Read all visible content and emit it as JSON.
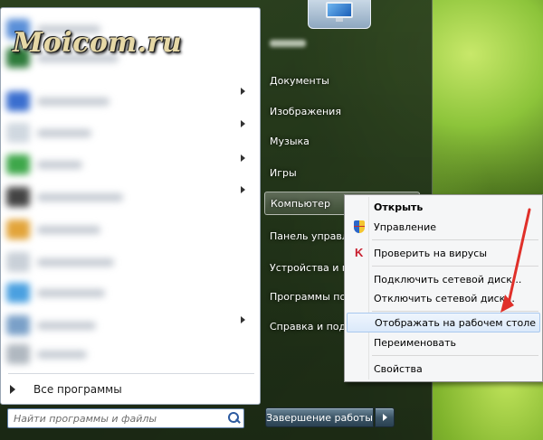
{
  "watermark": {
    "logo_text": "Moicom.ru"
  },
  "start_menu": {
    "all_programs_label": "Все программы",
    "search": {
      "placeholder": "Найти программы и файлы"
    },
    "right_items": [
      {
        "label": "Документы"
      },
      {
        "label": "Изображения"
      },
      {
        "label": "Музыка"
      },
      {
        "label": "Игры"
      },
      {
        "label": "Компьютер"
      },
      {
        "label": "Панель управл"
      },
      {
        "label": "Устройства и пр"
      },
      {
        "label": "Программы по"
      },
      {
        "label": "Справка и подд"
      }
    ],
    "shutdown_label": "Завершение работы"
  },
  "context_menu": {
    "items": [
      {
        "label": "Открыть"
      },
      {
        "label": "Управление"
      },
      {
        "label": "Проверить на вирусы"
      },
      {
        "label": "Подключить сетевой диск..."
      },
      {
        "label": "Отключить сетевой диск..."
      },
      {
        "label": "Отображать на рабочем столе"
      },
      {
        "label": "Переименовать"
      },
      {
        "label": "Свойства"
      }
    ]
  },
  "colors": {
    "annotation_arrow": "#e0302a",
    "menu_highlight_border": "#a8c8ee"
  }
}
